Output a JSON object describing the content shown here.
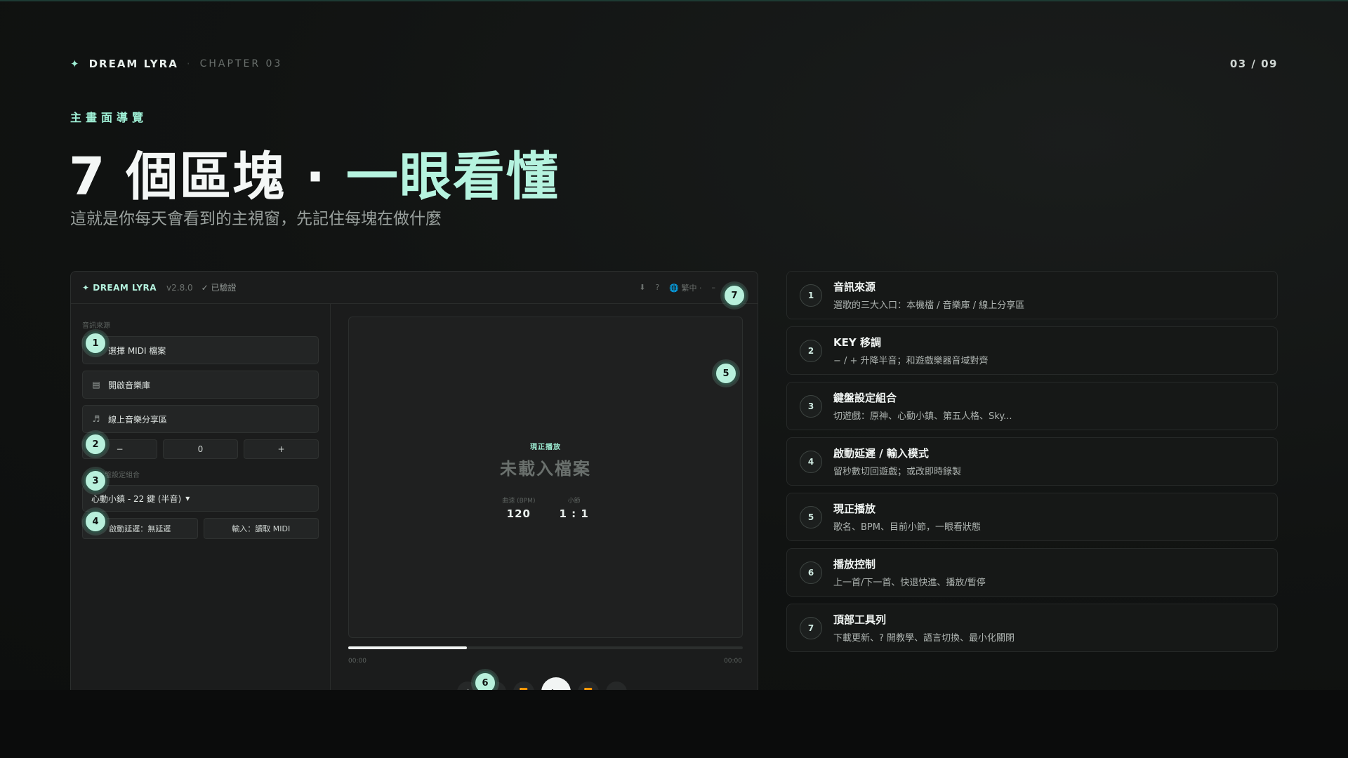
{
  "header": {
    "brand": "DREAM LYRA",
    "brand_star": "✦",
    "separator": "·",
    "chapter": "CHAPTER 03",
    "page": "03 / 09"
  },
  "hero": {
    "eyebrow": "主畫面導覽",
    "title_main": "7 個區塊 · ",
    "title_accent": "一眼看懂",
    "subtitle": "這就是你每天會看到的主視窗，先記住每塊在做什麼"
  },
  "app": {
    "brand": "✦ DREAM LYRA",
    "version": "v2.8.0",
    "verified": "✓ 已驗證",
    "tools": {
      "download": "⬇",
      "help": "?",
      "language": "🌐 繁中 ·",
      "minimize": "–"
    },
    "sources_label": "音訊來源",
    "sources": [
      {
        "icon": "",
        "label": "選擇 MIDI 檔案"
      },
      {
        "icon": "▤",
        "label": "開啟音樂庫"
      },
      {
        "icon": "♬",
        "label": "線上音樂分享區"
      }
    ],
    "key": {
      "minus": "−",
      "value": "0",
      "plus": "+"
    },
    "keyboard_label": "鍵盤設定組合",
    "keyboard_select": "心動小鎮 - 22 鍵 (半音)",
    "keyboard_caret": "▾",
    "delay_button": "啟動延遲：無延遲",
    "input_button": "輸入：讀取 MIDI",
    "now_playing": {
      "label": "現正播放",
      "title": "未載入檔案",
      "bpm_label": "曲速 (BPM)",
      "bpm": "120",
      "bar_label": "小節",
      "bar": "1 : 1"
    },
    "progress": 0.3,
    "time_start": "00:00",
    "time_end": "00:00",
    "controls": [
      "♪",
      "⏮",
      "⏪",
      "▶",
      "⏩",
      "⏭"
    ]
  },
  "badges": [
    "1",
    "2",
    "3",
    "4",
    "5",
    "6",
    "7"
  ],
  "legend": [
    {
      "num": "1",
      "title": "音訊來源",
      "desc": "選歌的三大入口：本機檔 / 音樂庫 / 線上分享區"
    },
    {
      "num": "2",
      "title": "KEY 移調",
      "desc": "− / + 升降半音；和遊戲樂器音域對齊"
    },
    {
      "num": "3",
      "title": "鍵盤設定組合",
      "desc": "切遊戲：原神、心動小鎮、第五人格、Sky..."
    },
    {
      "num": "4",
      "title": "啟動延遲 / 輸入模式",
      "desc": "留秒數切回遊戲；或改即時錄製"
    },
    {
      "num": "5",
      "title": "現正播放",
      "desc": "歌名、BPM、目前小節，一眼看狀態"
    },
    {
      "num": "6",
      "title": "播放控制",
      "desc": "上一首/下一首、快退快進、播放/暫停"
    },
    {
      "num": "7",
      "title": "頂部工具列",
      "desc": "下載更新、? 開教學、語言切換、最小化關閉"
    }
  ],
  "colors": {
    "accent": "#9ff0d6",
    "badge": "#b8f0dc",
    "background": "#0f1110"
  }
}
